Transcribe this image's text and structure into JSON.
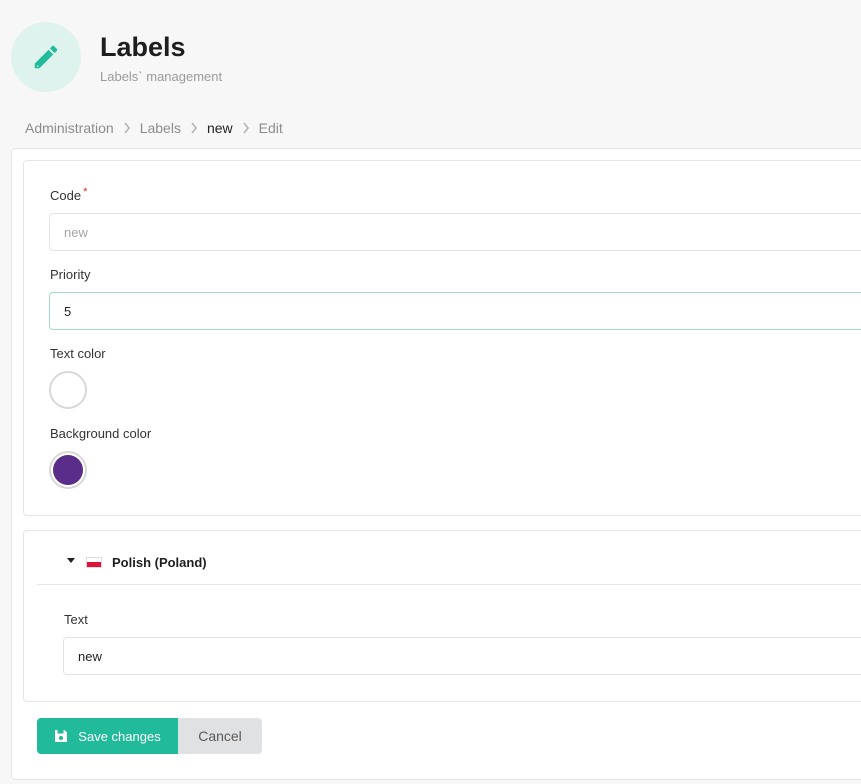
{
  "header": {
    "icon": "pencil-icon",
    "title": "Labels",
    "subtitle": "Labels` management"
  },
  "breadcrumb": {
    "items": [
      "Administration",
      "Labels",
      "new",
      "Edit"
    ]
  },
  "form": {
    "code": {
      "label": "Code",
      "required_mark": "*",
      "value": "new"
    },
    "priority": {
      "label": "Priority",
      "value": "5"
    },
    "text_color": {
      "label": "Text color",
      "value": "#ffffff"
    },
    "background_color": {
      "label": "Background color",
      "value": "#5b2d8a"
    }
  },
  "translations": {
    "language": "Polish (Poland)",
    "flag_icon": "poland-flag-icon",
    "expanded": true,
    "text": {
      "label": "Text",
      "value": "new"
    }
  },
  "actions": {
    "save_label": "Save changes",
    "save_icon": "save-icon",
    "cancel_label": "Cancel"
  },
  "colors": {
    "accent": "#21ba9a",
    "cancel_bg": "#e0e1e2"
  }
}
